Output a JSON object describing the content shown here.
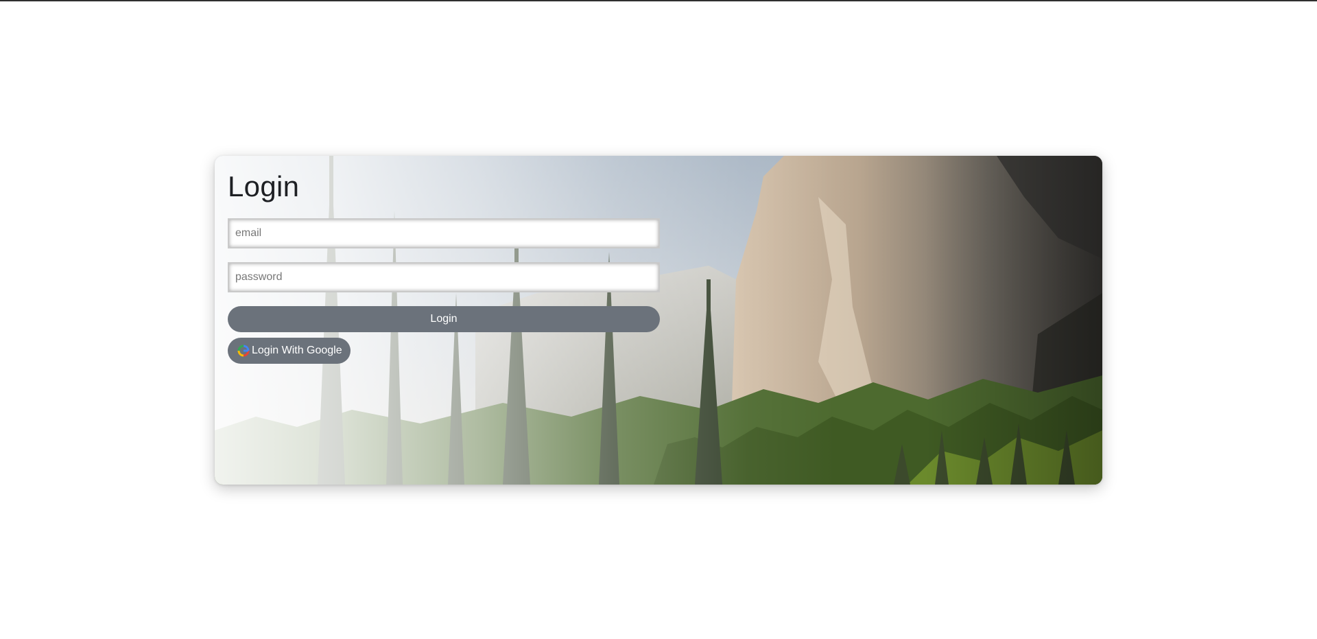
{
  "login": {
    "title": "Login",
    "email_placeholder": "email",
    "password_placeholder": "password",
    "login_button": "Login",
    "google_button": "Login With Google"
  },
  "colors": {
    "button_bg": "#6b727b",
    "title_text": "#1e2024",
    "page_bg": "#ffffff"
  },
  "icons": {
    "google": "google-icon"
  }
}
